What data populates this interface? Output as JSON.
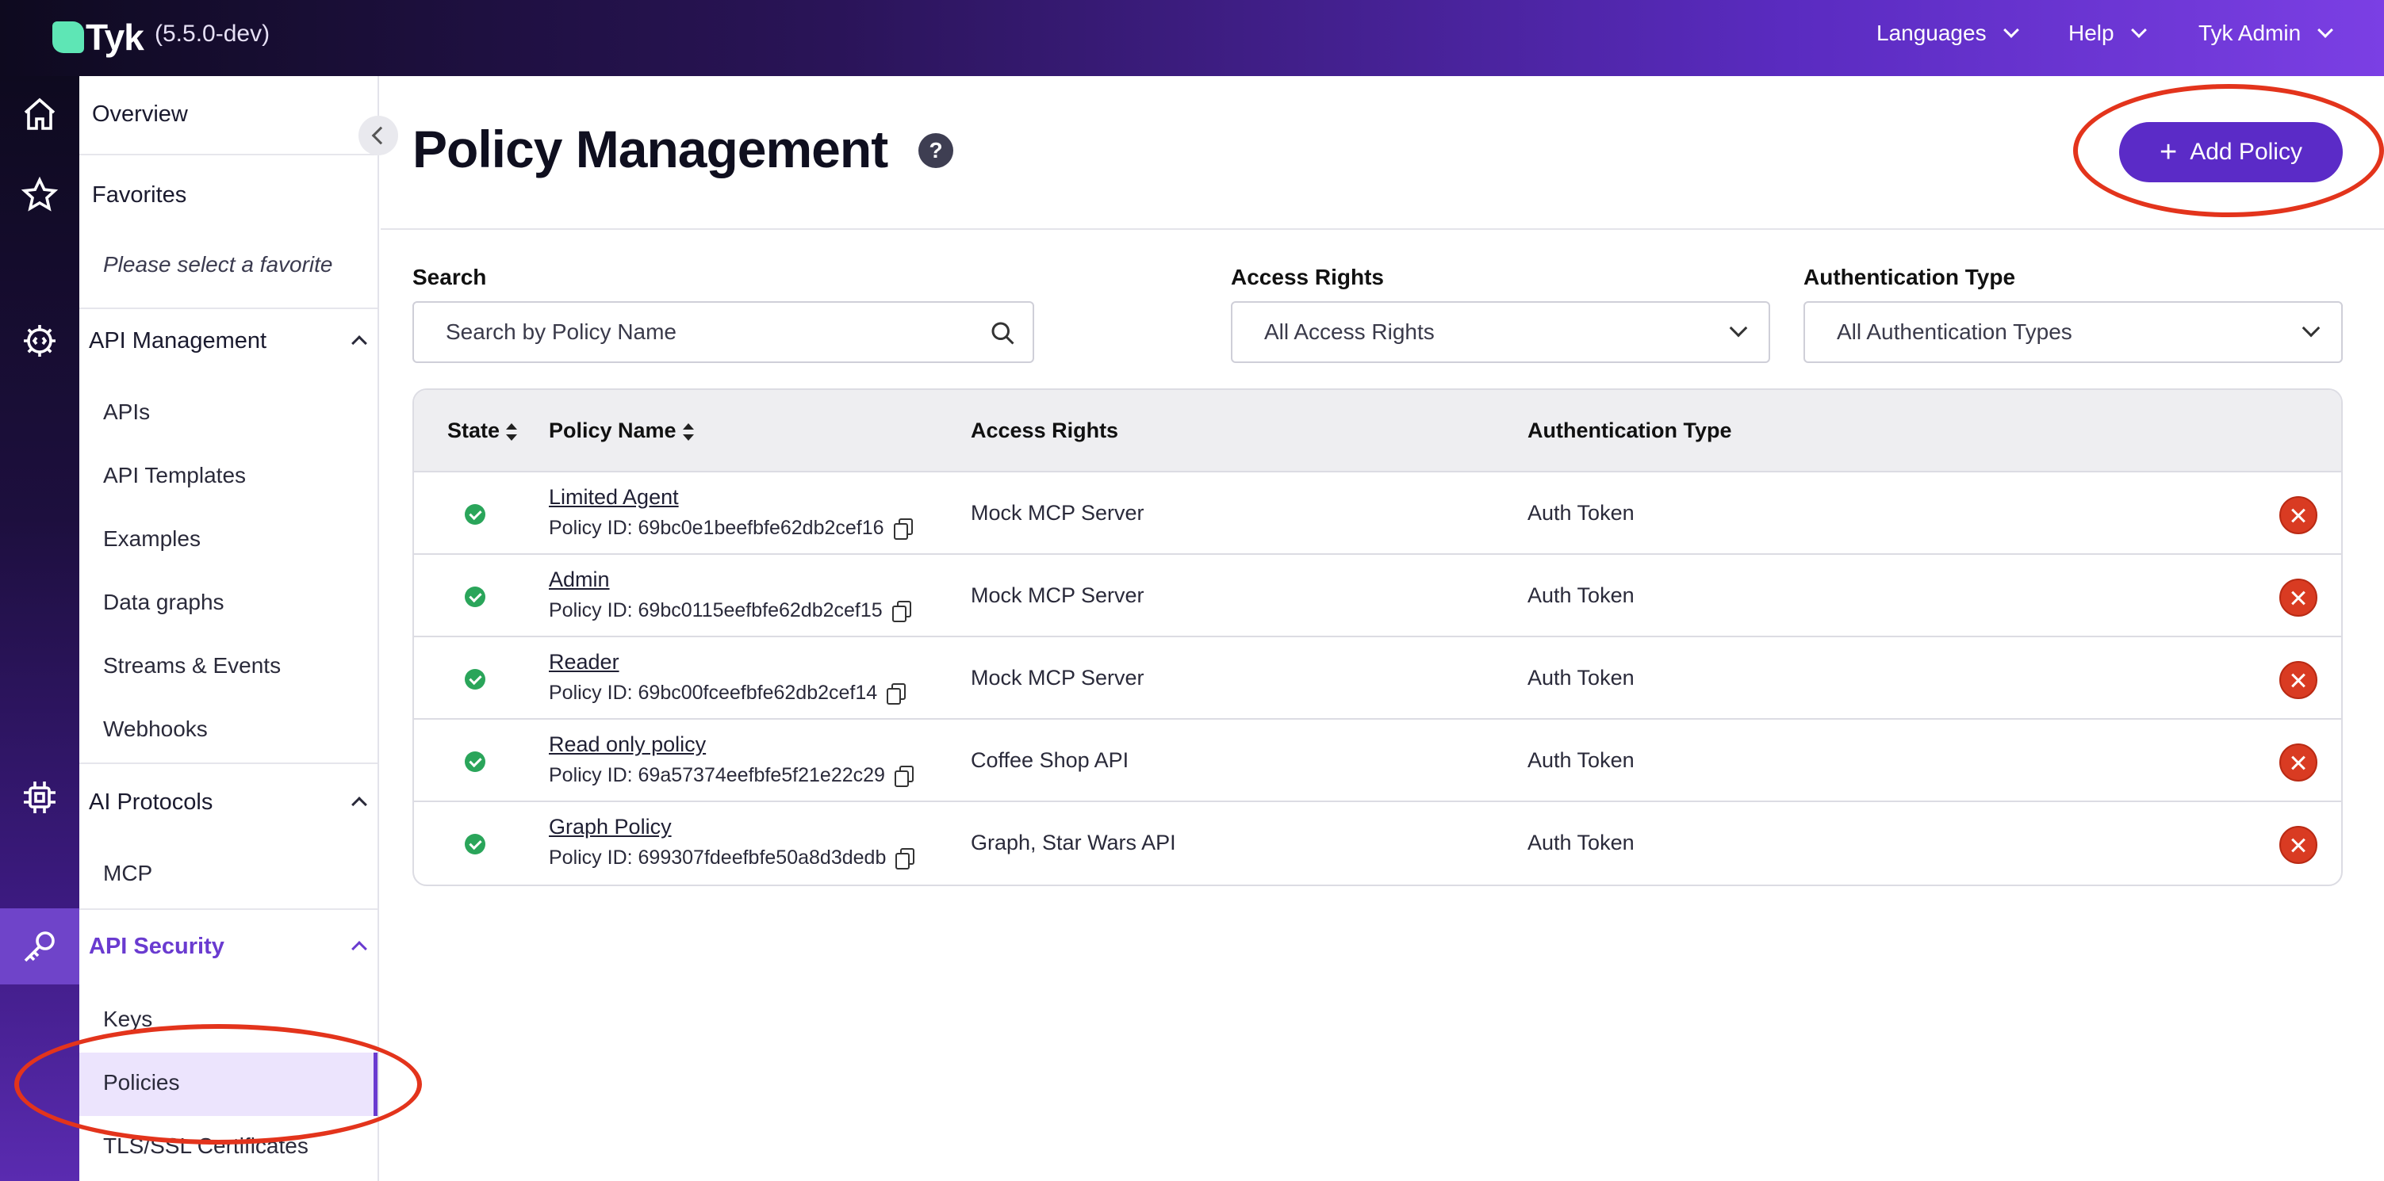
{
  "app": {
    "logo_text": "Tyk",
    "version": "(5.5.0-dev)"
  },
  "topnav": {
    "languages": "Languages",
    "help": "Help",
    "user": "Tyk Admin"
  },
  "sidebar": {
    "overview": "Overview",
    "favorites": "Favorites",
    "favorites_placeholder": "Please select a favorite",
    "api_management": {
      "title": "API Management",
      "items": [
        "APIs",
        "API Templates",
        "Examples",
        "Data graphs",
        "Streams & Events",
        "Webhooks"
      ]
    },
    "ai_protocols": {
      "title": "AI Protocols",
      "items": [
        "MCP"
      ]
    },
    "api_security": {
      "title": "API Security",
      "items": [
        "Keys",
        "Policies",
        "TLS/SSL Certificates"
      ]
    }
  },
  "page": {
    "title": "Policy Management",
    "help": "?",
    "add_button": "Add Policy"
  },
  "filters": {
    "search": {
      "label": "Search",
      "placeholder": "Search by Policy Name"
    },
    "access_rights": {
      "label": "Access Rights",
      "value": "All Access Rights"
    },
    "auth_type": {
      "label": "Authentication Type",
      "value": "All Authentication Types"
    }
  },
  "table": {
    "headers": {
      "state": "State",
      "policy_name": "Policy Name",
      "access_rights": "Access Rights",
      "auth_type": "Authentication Type"
    },
    "rows": [
      {
        "name": "Limited Agent",
        "id": "Policy ID: 69bc0e1beefbfe62db2cef16",
        "access": "Mock MCP Server",
        "auth": "Auth Token"
      },
      {
        "name": "Admin",
        "id": "Policy ID: 69bc0115eefbfe62db2cef15",
        "access": "Mock MCP Server",
        "auth": "Auth Token"
      },
      {
        "name": "Reader",
        "id": "Policy ID: 69bc00fceefbfe62db2cef14",
        "access": "Mock MCP Server",
        "auth": "Auth Token"
      },
      {
        "name": "Read only policy",
        "id": "Policy ID: 69a57374eefbfe5f21e22c29",
        "access": "Coffee Shop API",
        "auth": "Auth Token"
      },
      {
        "name": "Graph Policy",
        "id": "Policy ID: 699307fdeefbfe50a8d3dedb",
        "access": "Graph, Star Wars API",
        "auth": "Auth Token"
      }
    ]
  },
  "colors": {
    "accent": "#5b2bc7",
    "annotation": "#e3341c",
    "active_state": "#2aa55a",
    "delete": "#d93b22"
  }
}
